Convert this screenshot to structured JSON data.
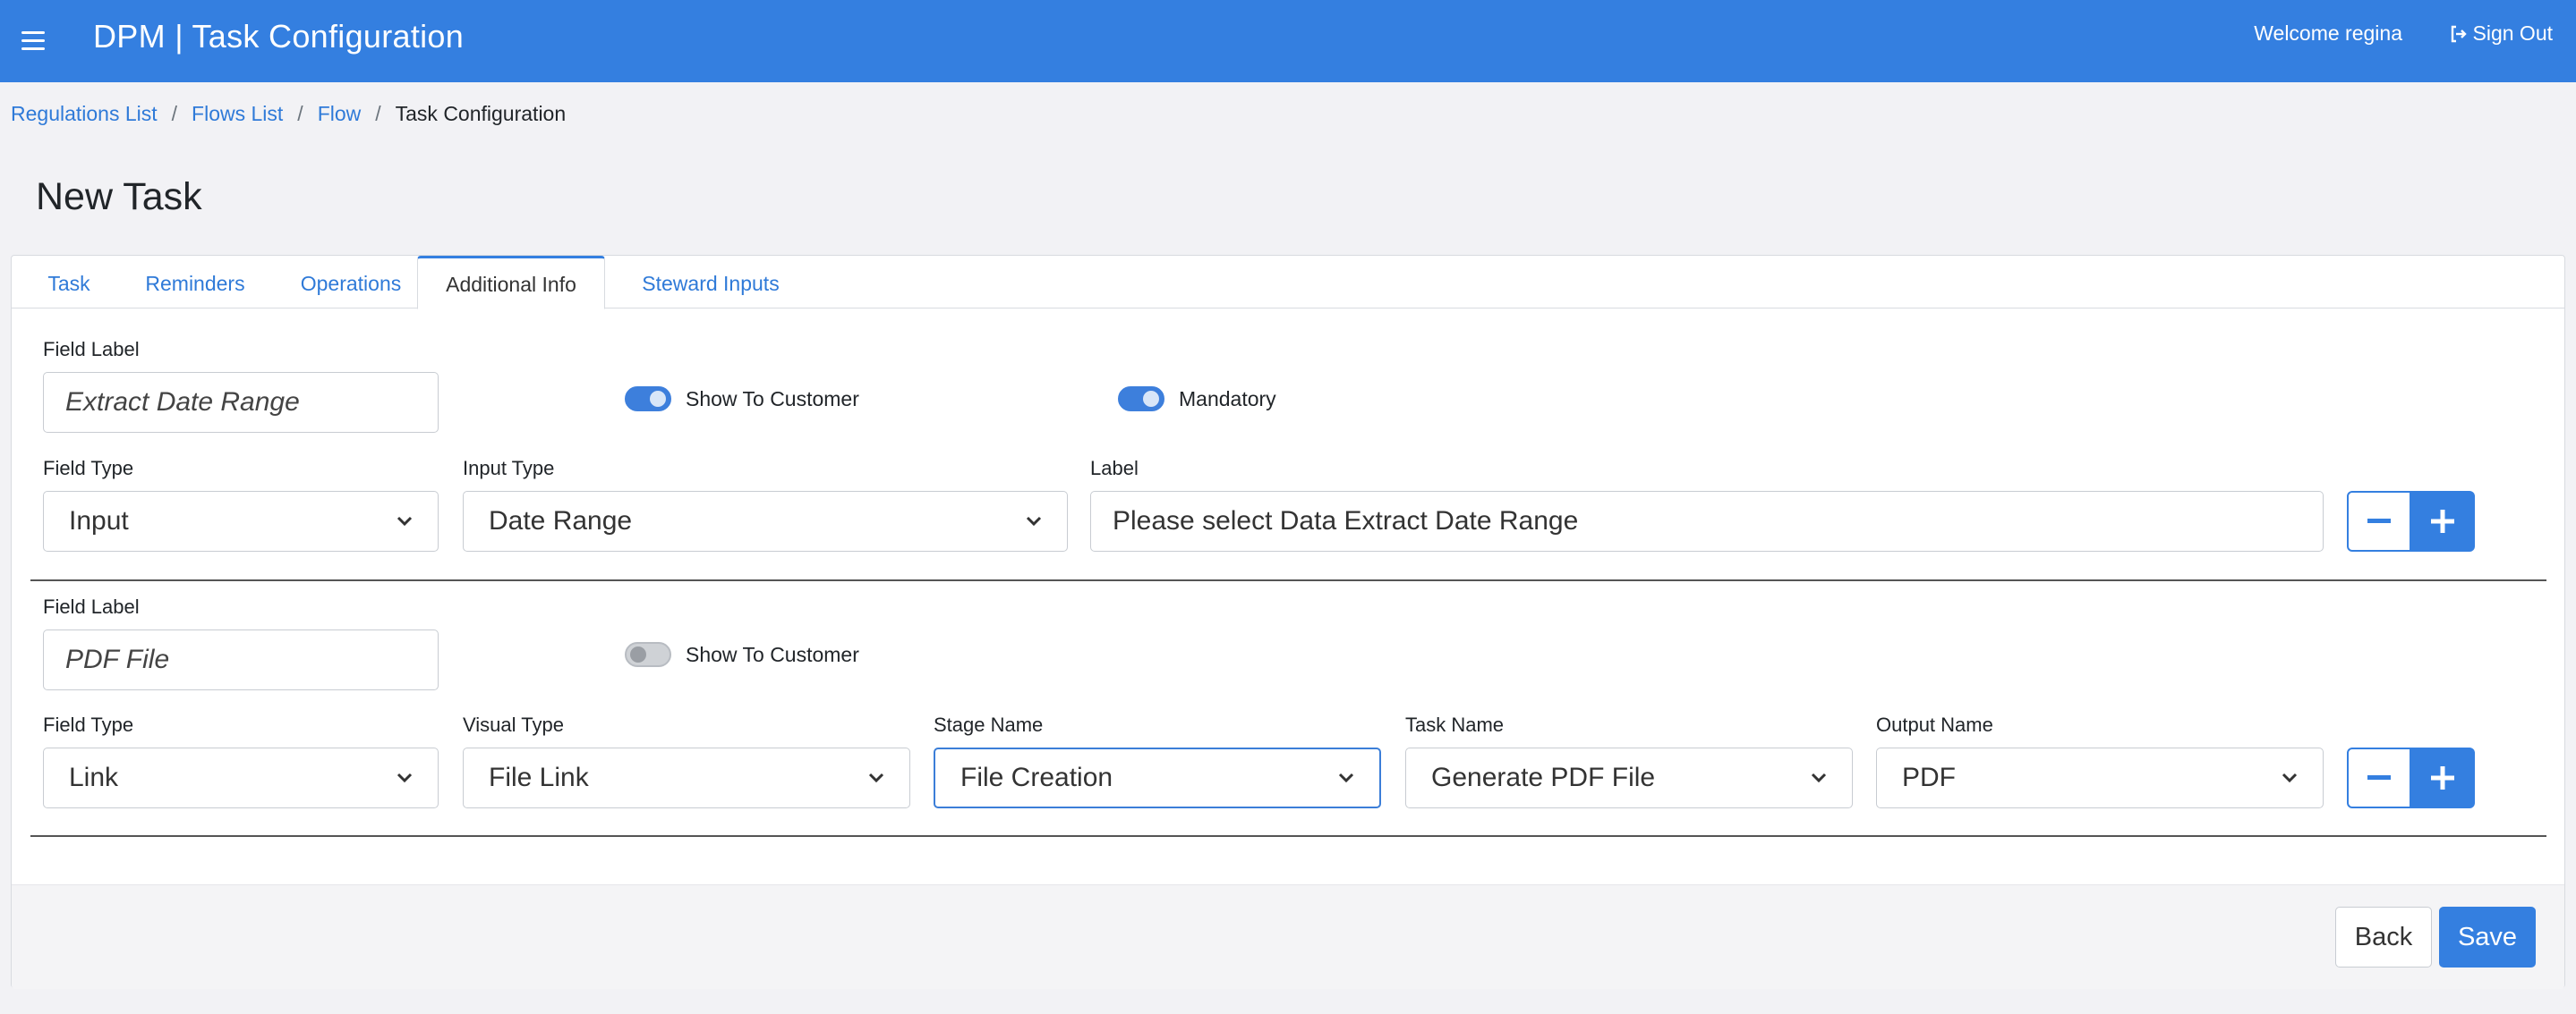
{
  "header": {
    "app_title": "DPM | Task Configuration",
    "welcome": "Welcome regina",
    "sign_out": "Sign Out",
    "brand_color": "#347fe0"
  },
  "breadcrumb": {
    "items": [
      "Regulations List",
      "Flows List",
      "Flow"
    ],
    "current": "Task Configuration",
    "separator": "/"
  },
  "page_title": "New Task",
  "tabs": [
    {
      "label": "Task"
    },
    {
      "label": "Reminders"
    },
    {
      "label": "Operations"
    },
    {
      "label": "Additional Info",
      "active": true
    },
    {
      "label": "Steward Inputs"
    }
  ],
  "fields": [
    {
      "field_label_caption": "Field Label",
      "field_label_value": "Extract Date Range",
      "show_to_customer_label": "Show To Customer",
      "show_to_customer": true,
      "mandatory_label": "Mandatory",
      "mandatory": true,
      "field_type_caption": "Field Type",
      "field_type_value": "Input",
      "input_type_caption": "Input Type",
      "input_type_value": "Date Range",
      "label_caption": "Label",
      "label_value": "Please select Data Extract Date Range"
    },
    {
      "field_label_caption": "Field Label",
      "field_label_value": "PDF File",
      "show_to_customer_label": "Show To Customer",
      "show_to_customer": false,
      "field_type_caption": "Field Type",
      "field_type_value": "Link",
      "visual_type_caption": "Visual Type",
      "visual_type_value": "File Link",
      "stage_name_caption": "Stage Name",
      "stage_name_value": "File Creation",
      "task_name_caption": "Task Name",
      "task_name_value": "Generate PDF File",
      "output_name_caption": "Output Name",
      "output_name_value": "PDF"
    }
  ],
  "footer": {
    "back_label": "Back",
    "save_label": "Save"
  }
}
